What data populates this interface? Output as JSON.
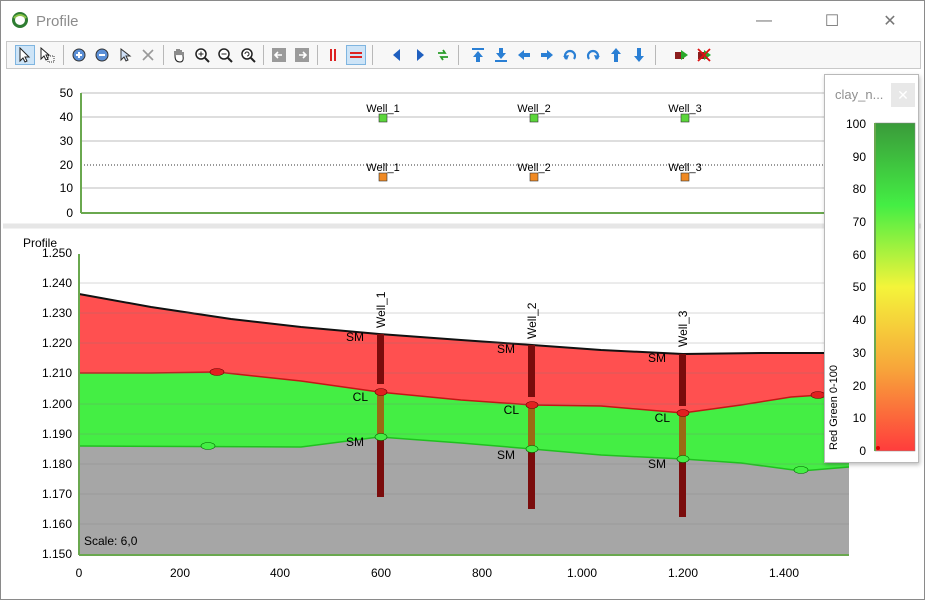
{
  "window": {
    "title": "Profile",
    "controls": [
      "—",
      "☐",
      "✕"
    ]
  },
  "toolbar": {
    "buttons": [
      "select-arrow",
      "select-multi",
      "zoom-layer-1",
      "zoom-layer-2",
      "select-cursor",
      "delete",
      "pan",
      "zoom-in",
      "zoom-out",
      "zoom-extent",
      "nav-back",
      "nav-forward",
      "vertical-marker",
      "horizontal-marker",
      "arrow-left",
      "arrow-right",
      "refresh",
      "move-top",
      "move-bottom",
      "move-left",
      "move-right",
      "undo",
      "redo",
      "move-up",
      "move-down",
      "export",
      "remove-export"
    ]
  },
  "top_chart": {
    "y_ticks": [
      "50",
      "40",
      "30",
      "20",
      "10",
      "0"
    ],
    "wells_upper": [
      "Well_1",
      "Well_2",
      "Well_3"
    ],
    "wells_lower": [
      "Well_1",
      "Well_2",
      "Well_3"
    ]
  },
  "profile_chart": {
    "label": "Profile",
    "y_ticks": [
      "1.250",
      "1.240",
      "1.230",
      "1.220",
      "1.210",
      "1.200",
      "1.190",
      "1.180",
      "1.170",
      "1.160",
      "1.150"
    ],
    "x_ticks": [
      "0",
      "200",
      "400",
      "600",
      "800",
      "1.000",
      "1.200",
      "1.400"
    ],
    "scale_text": "Scale: 6,0",
    "wells": [
      {
        "name": "Well_1",
        "x": 600,
        "top": 1.2233,
        "bottom": 1.1693,
        "layers": [
          "SM",
          "CL",
          "SM"
        ]
      },
      {
        "name": "Well_2",
        "x": 900,
        "top": 1.2197,
        "bottom": 1.1647,
        "layers": [
          "SM",
          "CL",
          "SM"
        ]
      },
      {
        "name": "Well_3",
        "x": 1200,
        "top": 1.2165,
        "bottom": 1.162,
        "layers": [
          "SM",
          "CL",
          "SM"
        ]
      }
    ],
    "colors": {
      "layer_top": "#ff5050",
      "layer_mid": "#44ee44",
      "layer_base": "#a6a6a6"
    }
  },
  "legend": {
    "title": "clay_n...",
    "close": "✕",
    "axis_label": "Red Green 0-100",
    "ticks": [
      "100",
      "90",
      "80",
      "70",
      "60",
      "50",
      "40",
      "30",
      "20",
      "10",
      "0"
    ]
  }
}
